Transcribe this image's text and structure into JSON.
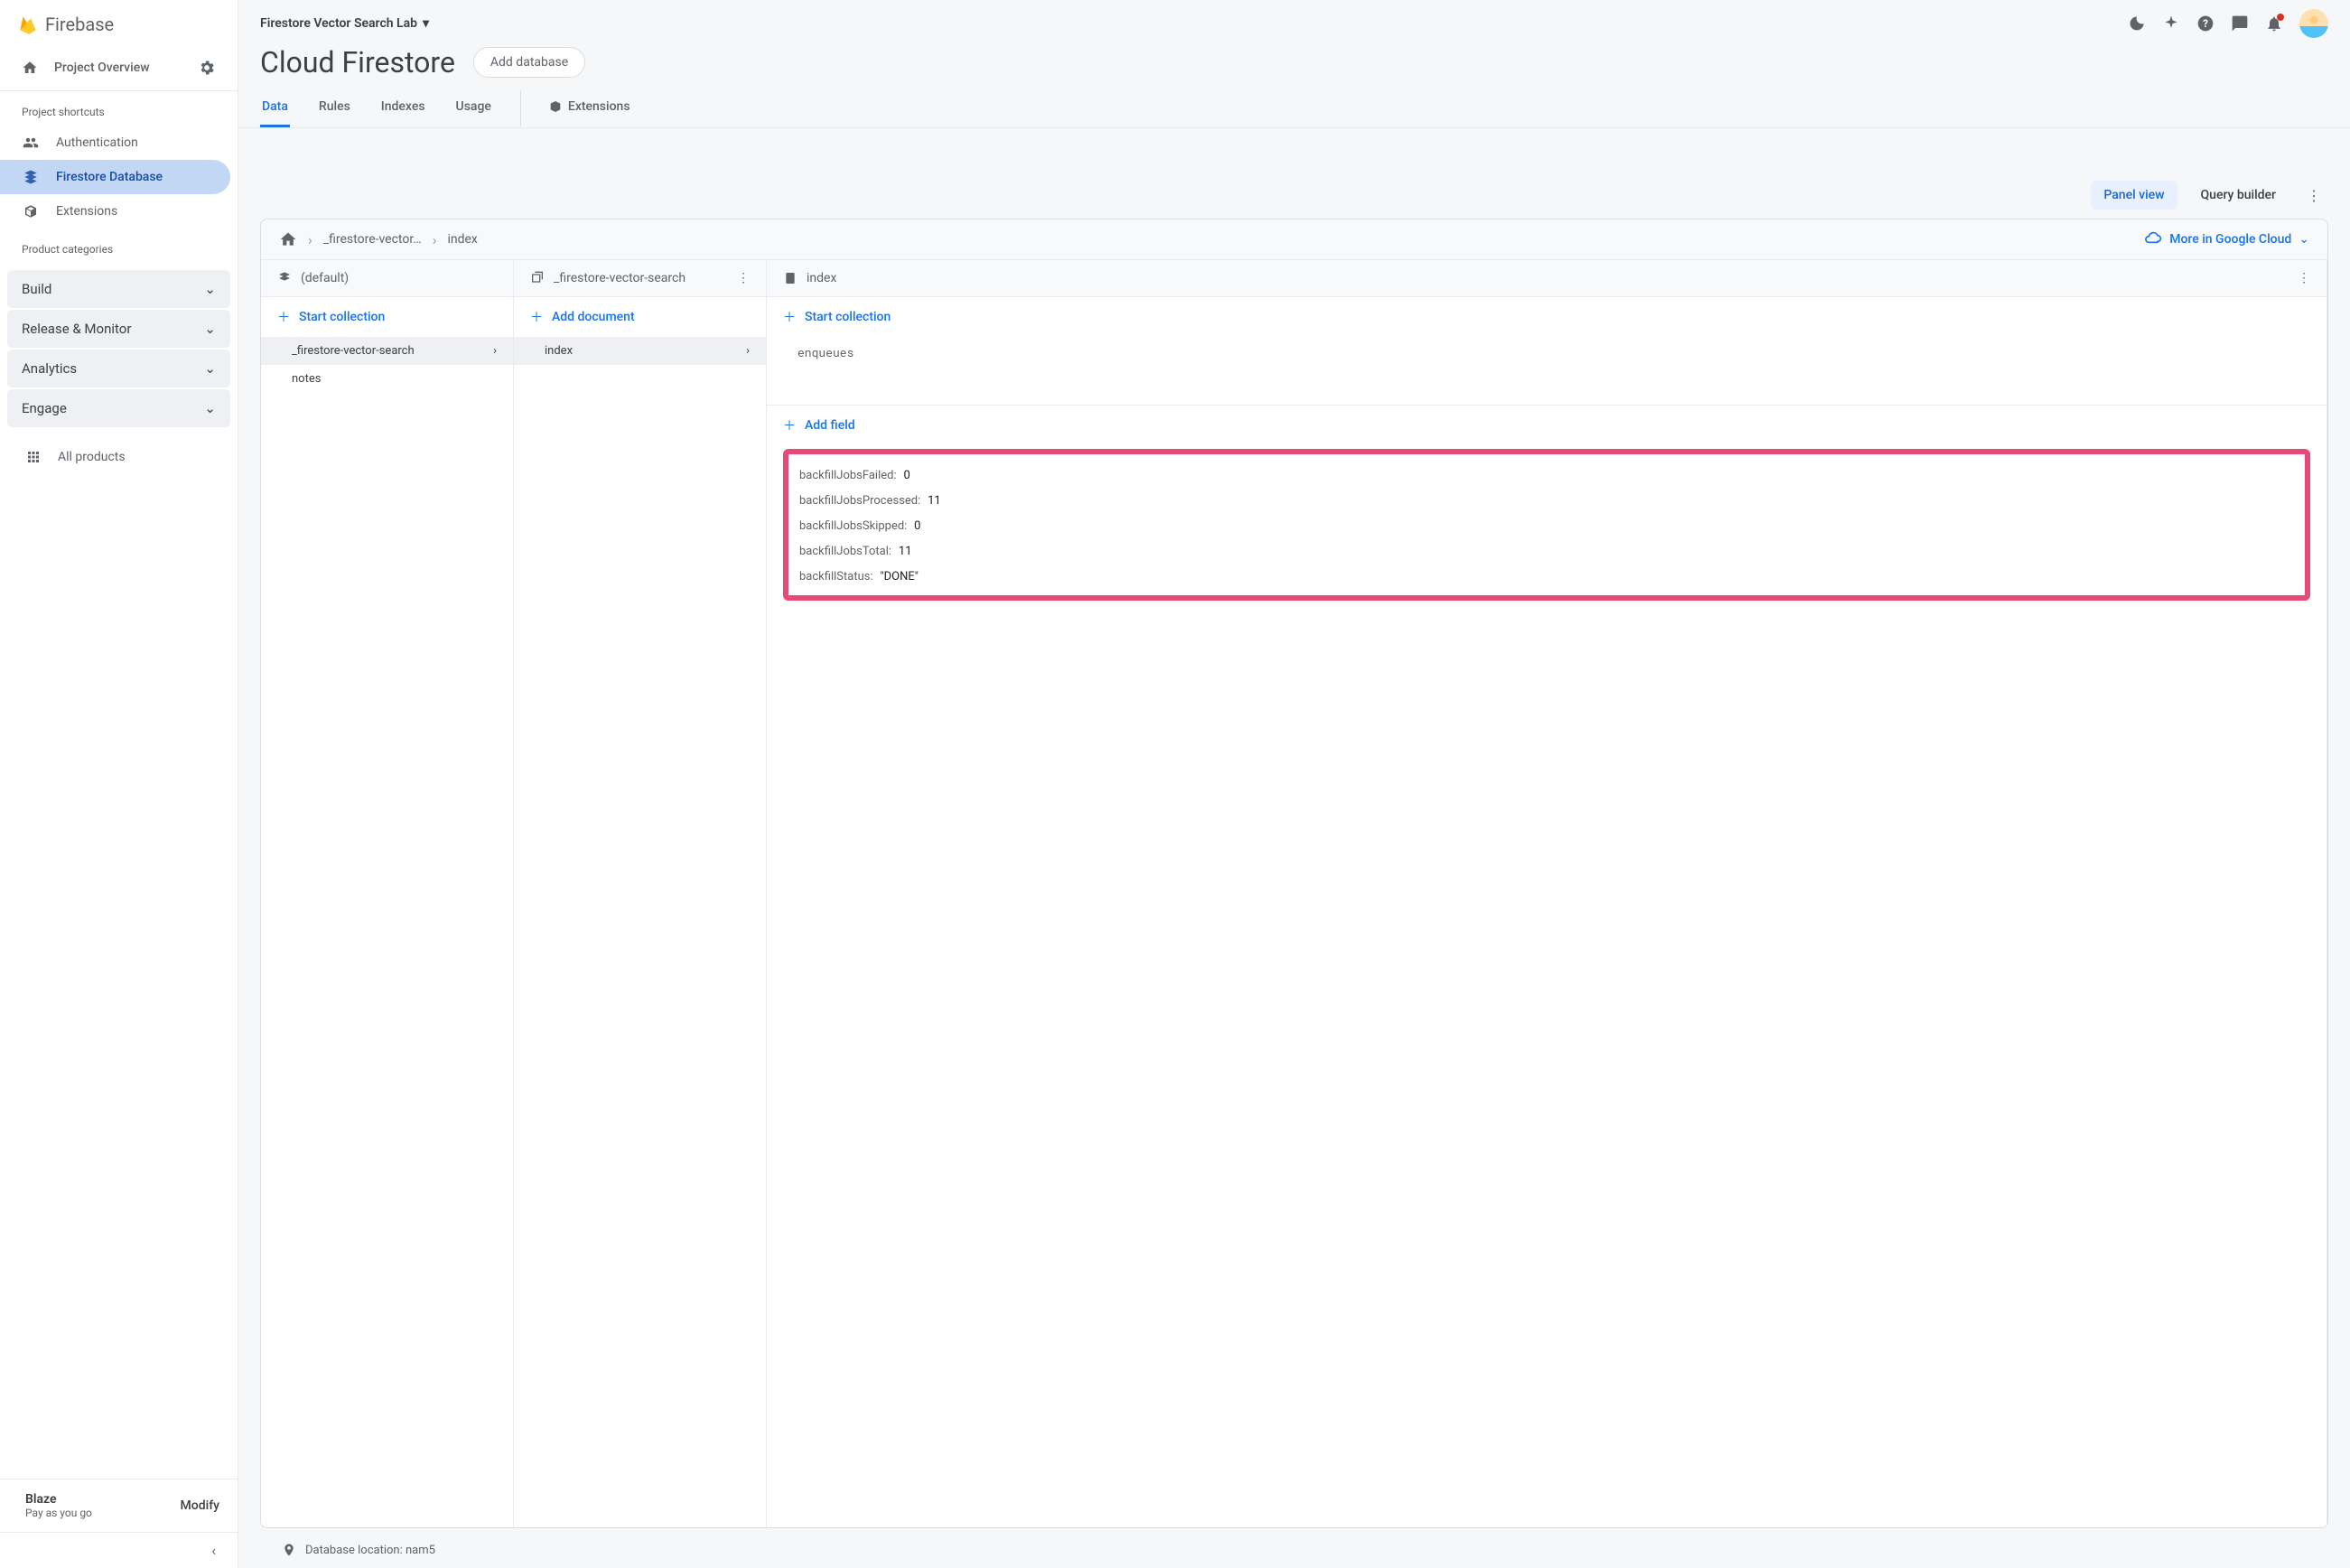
{
  "brand": "Firebase",
  "project_name": "Firestore Vector Search Lab",
  "overview_label": "Project Overview",
  "shortcuts_label": "Project shortcuts",
  "shortcut_items": [
    {
      "label": "Authentication"
    },
    {
      "label": "Firestore Database"
    },
    {
      "label": "Extensions"
    }
  ],
  "categories_label": "Product categories",
  "categories": [
    {
      "label": "Build"
    },
    {
      "label": "Release & Monitor"
    },
    {
      "label": "Analytics"
    },
    {
      "label": "Engage"
    }
  ],
  "all_products_label": "All products",
  "plan": {
    "name": "Blaze",
    "sub": "Pay as you go",
    "modify": "Modify"
  },
  "page_title": "Cloud Firestore",
  "add_db_label": "Add database",
  "tabs": [
    "Data",
    "Rules",
    "Indexes",
    "Usage"
  ],
  "tab_ext": "Extensions",
  "view_toggle": {
    "panel": "Panel view",
    "query": "Query builder"
  },
  "gcloud_link": "More in Google Cloud",
  "breadcrumb": [
    "_firestore-vector…",
    "index"
  ],
  "col1": {
    "head": "(default)",
    "action": "Start collection",
    "items": [
      "_firestore-vector-search",
      "notes"
    ]
  },
  "col2": {
    "head": "_firestore-vector-search",
    "action": "Add document",
    "items": [
      "index"
    ]
  },
  "col3": {
    "head": "index",
    "action1": "Start collection",
    "sub": "enqueues",
    "action2": "Add field"
  },
  "fields": [
    {
      "k": "backfillJobsFailed",
      "v": "0"
    },
    {
      "k": "backfillJobsProcessed",
      "v": "11"
    },
    {
      "k": "backfillJobsSkipped",
      "v": "0"
    },
    {
      "k": "backfillJobsTotal",
      "v": "11"
    },
    {
      "k": "backfillStatus",
      "v": "\"DONE\""
    }
  ],
  "footer": "Database location: nam5"
}
